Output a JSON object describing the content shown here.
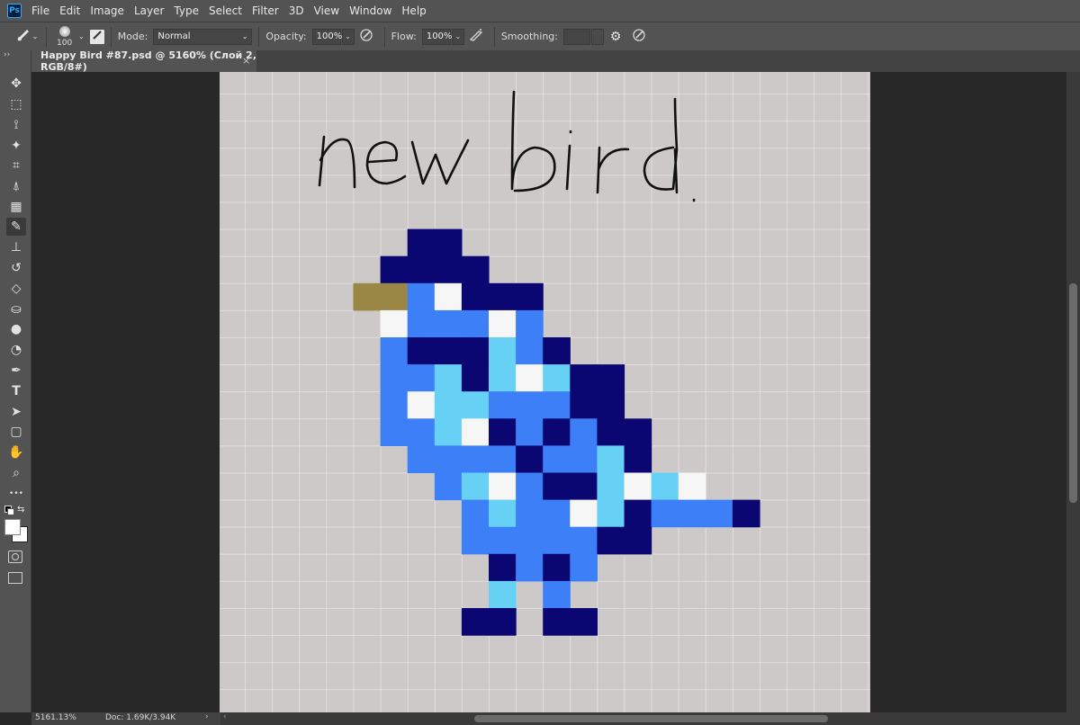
{
  "app": {
    "logo_text": "Ps"
  },
  "menu": [
    "File",
    "Edit",
    "Image",
    "Layer",
    "Type",
    "Select",
    "Filter",
    "3D",
    "View",
    "Window",
    "Help"
  ],
  "options": {
    "brush_size": "100",
    "mode_label": "Mode:",
    "mode_value": "Normal",
    "opacity_label": "Opacity:",
    "opacity_value": "100%",
    "flow_label": "Flow:",
    "flow_value": "100%",
    "smoothing_label": "Smoothing:",
    "smoothing_value": ""
  },
  "toolbar": {
    "expand": "››",
    "tools": [
      "move-icon",
      "marquee-icon",
      "lasso-icon",
      "magic-wand-icon",
      "crop-icon",
      "eyedropper-icon",
      "healing-brush-icon",
      "brush-icon",
      "clone-stamp-icon",
      "history-brush-icon",
      "eraser-icon",
      "paint-bucket-icon",
      "blur-icon",
      "dodge-icon",
      "pen-icon",
      "type-icon",
      "path-selection-icon",
      "rectangle-icon",
      "hand-icon",
      "zoom-icon",
      "more-tools-icon"
    ],
    "active_tool": "brush-icon"
  },
  "document": {
    "tab_title": "Happy Bird #87.psd @ 5160% (Слой 2, RGB/8#)",
    "close": "×"
  },
  "status": {
    "zoom": "5161.13%",
    "doc_size": "Doc: 1.69K/3.94K",
    "arrow": "›"
  },
  "artwork": {
    "palette": {
      "N": "#0a0672",
      "B": "#3d7ff7",
      "C": "#66d1f5",
      "W": "#f6f6f6",
      "Y": "#9a8746"
    },
    "grid_origin_col": 5,
    "grid_origin_row": 6,
    "rows": [
      "..NN.......",
      ".NNNN......",
      "Y.BWNNN....",
      ".WBBBWB....",
      ".BNNNCBN...",
      ".BBCNCWCNN.",
      ".BWCCBBBNN.",
      ".BBCWNBNBNN",
      "..BBBBNBBCN",
      "...BCWBNNCWCW",
      "....BCBBWCNBBBN",
      "....BBBBBNN",
      ".....NBNB..",
      ".....C.B...",
      "....NN.NN.."
    ],
    "beak_cells": 2
  },
  "handwriting": {
    "text": "new bird"
  }
}
